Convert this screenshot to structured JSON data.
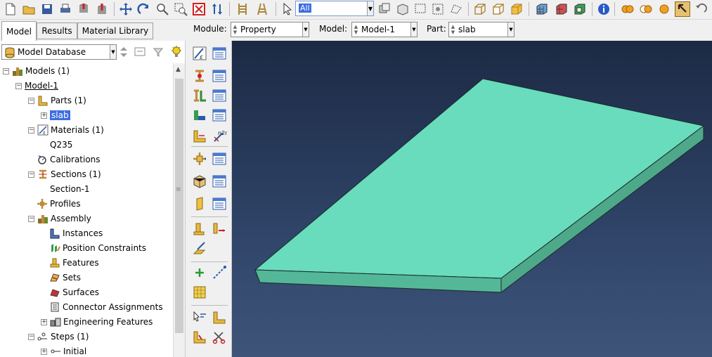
{
  "toolbar": {
    "selection_filter": "All"
  },
  "tabs": [
    {
      "label": "Model"
    },
    {
      "label": "Results"
    },
    {
      "label": "Material Library"
    }
  ],
  "context": {
    "module_label": "Module:",
    "module_value": "Property",
    "model_label": "Model:",
    "model_value": "Model-1",
    "part_label": "Part:",
    "part_value": "slab"
  },
  "database": {
    "value": "Model Database"
  },
  "tree": {
    "models": "Models (1)",
    "model1": "Model-1",
    "parts": "Parts (1)",
    "slab": "slab",
    "materials": "Materials (1)",
    "q235": "Q235",
    "calibrations": "Calibrations",
    "sections": "Sections (1)",
    "section1": "Section-1",
    "profiles": "Profiles",
    "assembly": "Assembly",
    "instances": "Instances",
    "position_constraints": "Position Constraints",
    "features": "Features",
    "sets": "Sets",
    "surfaces": "Surfaces",
    "connector_assignments": "Connector Assignments",
    "engineering_features": "Engineering Features",
    "steps": "Steps (1)",
    "initial": "Initial"
  },
  "colors": {
    "slab_top": "#68dcbc",
    "slab_front": "#54b898",
    "slab_side": "#4ea88a",
    "selection": "#3d6ee0"
  }
}
